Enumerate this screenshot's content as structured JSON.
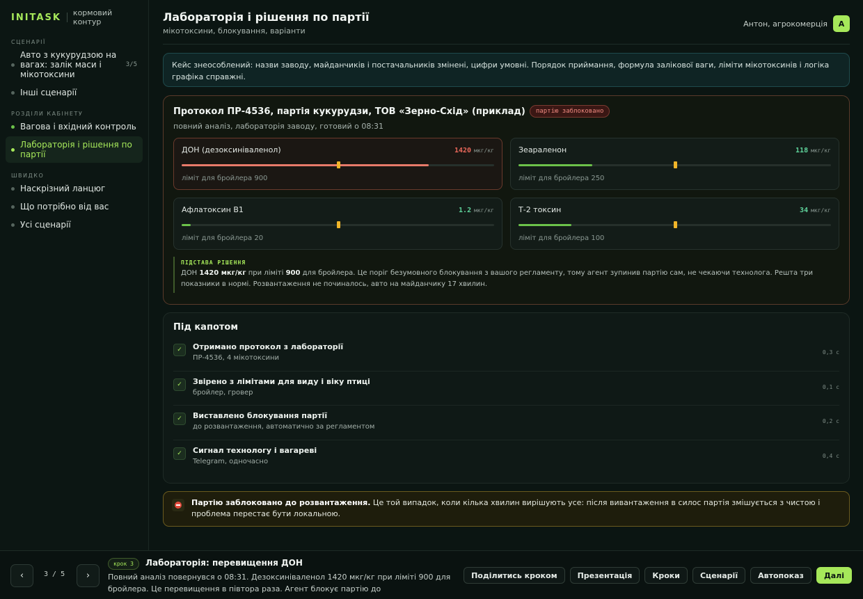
{
  "brand": {
    "name": "INITASK",
    "subtitle": "кормовий контур"
  },
  "sidebar": {
    "scenarios_heading": "СЦЕНАРІЇ",
    "scenarios": [
      {
        "label": "Авто з кукурудзою на вагах: залік маси і мікотоксини",
        "count": "3/5"
      },
      {
        "label": "Інші сценарії"
      }
    ],
    "sections_heading": "РОЗДІЛИ КАБІНЕТУ",
    "sections": [
      {
        "label": "Вагова і вхідний контроль"
      },
      {
        "label": "Лабораторія і рішення по партії",
        "active": true
      }
    ],
    "quick_heading": "ШВИДКО",
    "quick": [
      {
        "label": "Наскрізний ланцюг"
      },
      {
        "label": "Що потрібно від вас"
      },
      {
        "label": "Усі сценарії"
      }
    ]
  },
  "header": {
    "title": "Лабораторія і рішення по партії",
    "subtitle": "мікотоксини, блокування, варіанти",
    "user": "Антон, агрокомерція",
    "avatar": "А"
  },
  "notice": "Кейс знеособлений: назви заводу, майданчиків і постачальників змінені, цифри умовні. Порядок приймання, формула залікової ваги, ліміти мікотоксинів і логіка графіка справжні.",
  "protocol": {
    "title": "Протокол ПР-4536, партія кукурудзи, ТОВ «Зерно-Схід» (приклад)",
    "badge": "партію заблоковано",
    "subtitle": "повний аналіз, лабораторія заводу, готовий о 08:31",
    "toxins": [
      {
        "name": "ДОН (дезоксиніваленол)",
        "value": "1420",
        "unit": "мкг/кг",
        "limit": "ліміт для бройлера 900",
        "level": 0.79,
        "alert": true,
        "color": "#e8675a",
        "bar_color": "#e87a6a"
      },
      {
        "name": "Зеараленон",
        "value": "118",
        "unit": "мкг/кг",
        "limit": "ліміт для бройлера 250",
        "level": 0.236,
        "alert": false,
        "color": "#5fd39b",
        "bar_color": "#6cc24a"
      },
      {
        "name": "Афлатоксин B1",
        "value": "1.2",
        "unit": "мкг/кг",
        "limit": "ліміт для бройлера 20",
        "level": 0.03,
        "alert": false,
        "color": "#5fd39b",
        "bar_color": "#6cc24a"
      },
      {
        "name": "Т-2 токсин",
        "value": "34",
        "unit": "мкг/кг",
        "limit": "ліміт для бройлера 100",
        "level": 0.17,
        "alert": false,
        "color": "#5fd39b",
        "bar_color": "#6cc24a"
      }
    ],
    "basis_heading": "ПІДСТАВА РІШЕННЯ",
    "basis": {
      "p1": "ДОН ",
      "b1": "1420 мкг/кг",
      "p2": " при ліміті ",
      "b2": "900",
      "p3": " для бройлера. Це поріг безумовного блокування з вашого регламенту, тому агент зупинив партію сам, не чекаючи технолога. Решта три показники в нормі. Розвантаження не починалось, авто на майданчику 17 хвилин."
    }
  },
  "hood": {
    "title": "Під капотом",
    "steps": [
      {
        "title": "Отримано протокол з лабораторії",
        "sub": "ПР-4536, 4 мікотоксини",
        "time": "0,3 с"
      },
      {
        "title": "Звірено з лімітами для виду і віку птиці",
        "sub": "бройлер, гровер",
        "time": "0,1 с"
      },
      {
        "title": "Виставлено блокування партії",
        "sub": "до розвантаження, автоматично за регламентом",
        "time": "0,2 с"
      },
      {
        "title": "Сигнал технологу і вагареві",
        "sub": "Telegram, одночасно",
        "time": "0,4 с"
      }
    ]
  },
  "alert": {
    "bold": "Партію заблоковано до розвантаження.",
    "text": " Це той випадок, коли кілька хвилин вирішують усе: після вивантаження в силос партія змішується з чистою і проблема перестає бути локальною."
  },
  "bottom": {
    "counter": "3 / 5",
    "step_pill": "крок 3",
    "title": "Лабораторія: перевищення ДОН",
    "desc": "Повний аналіз повернувся о 08:31. Дезоксиніваленол 1420 мкг/кг при ліміті 900 для бройлера. Це перевищення в півтора раза. Агент блокує партію до розвантаження,...",
    "prev": "‹",
    "next": "›",
    "actions": [
      "Поділитись кроком",
      "Презентація",
      "Кроки",
      "Сценарії",
      "Автопоказ",
      "Далі"
    ]
  },
  "colors": {
    "accent": "#a6e85a",
    "danger": "#e8675a",
    "ok": "#5fd39b",
    "marker": "#f0b429"
  }
}
